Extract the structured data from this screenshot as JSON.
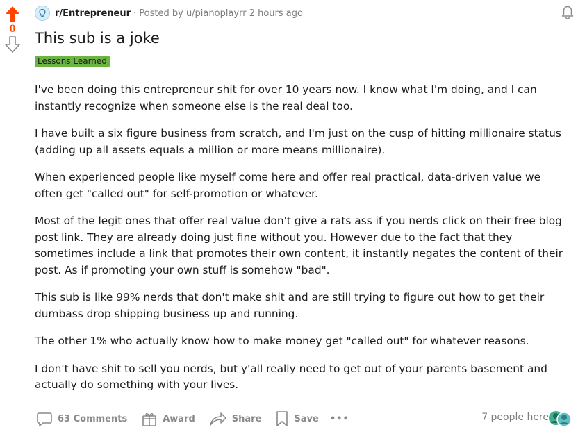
{
  "vote": {
    "score": "0",
    "upvote_color": "#ff4500"
  },
  "post": {
    "subreddit": "r/Entrepreneur",
    "posted_by": "· Posted by u/pianoplayrr 2 hours ago",
    "title": "This sub is a joke",
    "flair": "Lessons Learned",
    "flair_color": "#6cb542",
    "paragraphs": [
      "I've been doing this entrepreneur shit for over 10 years now. I know what I'm doing, and I can instantly recognize when someone else is the real deal too.",
      "I have built a six figure business from scratch, and I'm just on the cusp of hitting millionaire status (adding up all assets equals a million or more means millionaire).",
      "When experienced people like myself come here and offer real practical, data-driven value we often get \"called out\" for self-promotion or whatever.",
      "Most of the legit ones that offer real value don't give a rats ass if you nerds click on their free blog post link. They are already doing just fine without you. However due to the fact that they sometimes include a link that promotes their own content, it instantly negates the content of their post. As if promoting your own stuff is somehow \"bad\".",
      "This sub is like 99% nerds that don't make shit and are still trying to figure out how to get their dumbass drop shipping business up and running.",
      "The other 1% who actually know how to make money get \"called out\" for whatever reasons.",
      "I don't have shit to sell you nerds, but y'all really need to get out of your parents basement and actually do something with your lives."
    ]
  },
  "actions": {
    "comments": "63 Comments",
    "award": "Award",
    "share": "Share",
    "save": "Save",
    "more": "•••"
  },
  "presence": {
    "text": "7 people here"
  },
  "icons": {
    "upvote": "upvote-arrow-icon",
    "downvote": "downvote-arrow-icon",
    "subreddit": "lightbulb-icon",
    "bell": "bell-icon",
    "comment": "comment-bubble-icon",
    "award": "gift-award-icon",
    "share": "share-arrow-icon",
    "save": "bookmark-icon",
    "more": "ellipsis-icon"
  }
}
